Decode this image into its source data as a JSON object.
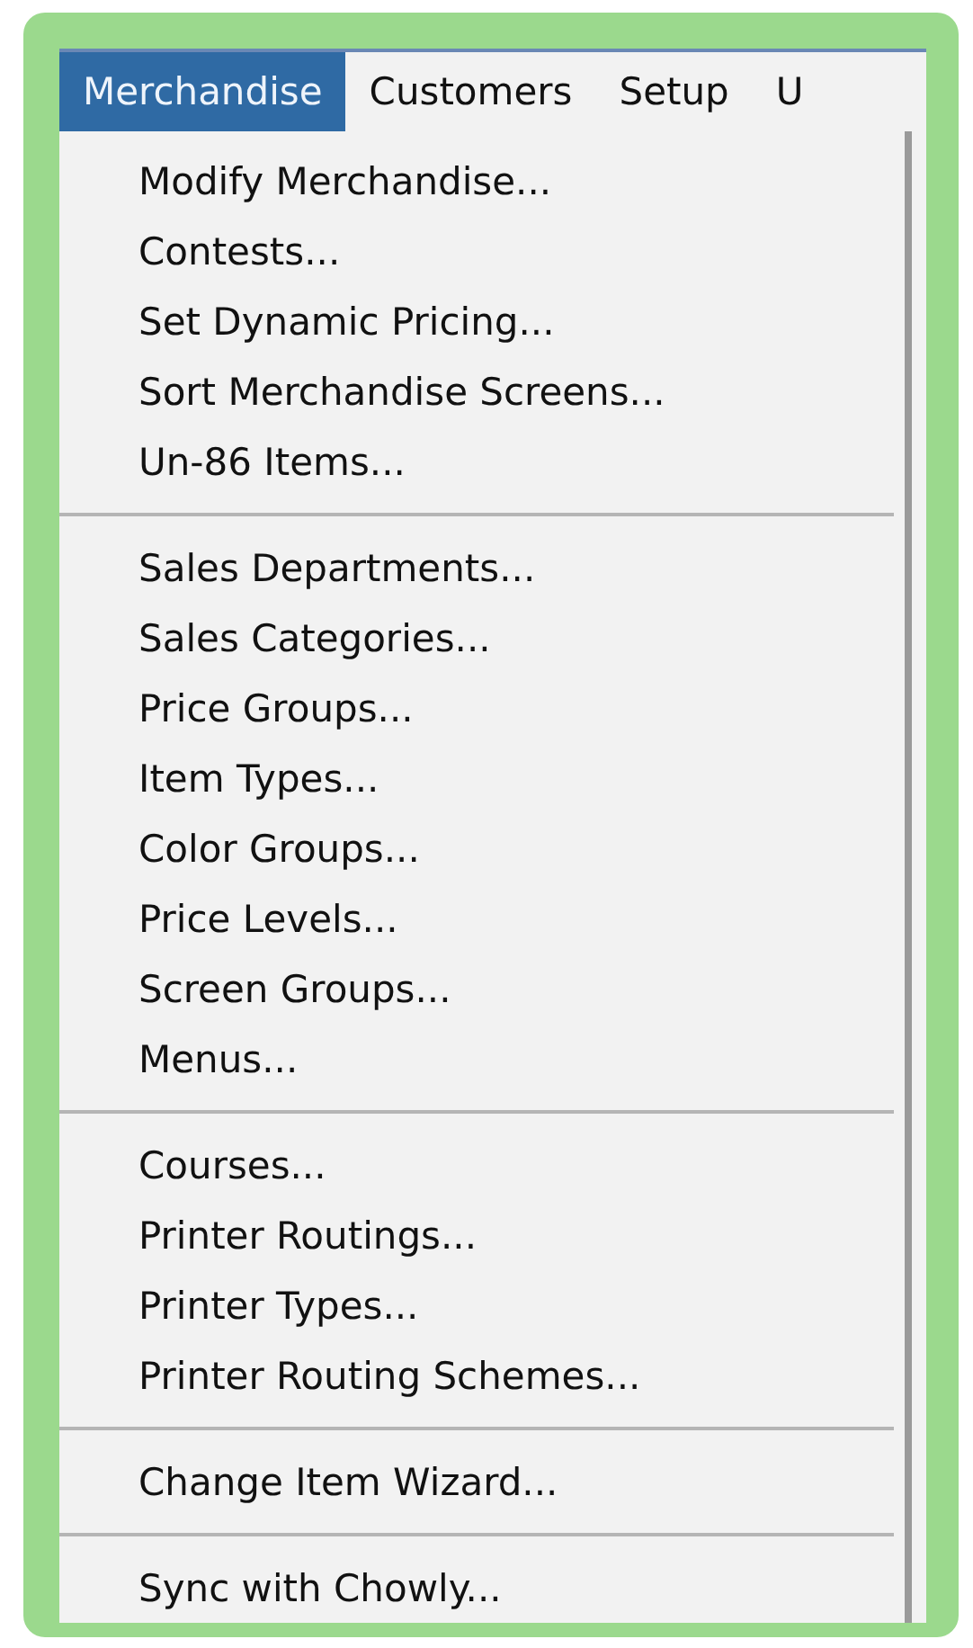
{
  "menu_bar": [
    {
      "label": "Merchandise",
      "selected": true
    },
    {
      "label": "Customers",
      "selected": false
    },
    {
      "label": "Setup",
      "selected": false
    },
    {
      "label": "U",
      "selected": false
    }
  ],
  "dropdown": {
    "groups": [
      {
        "items": [
          "Modify Merchandise...",
          "Contests...",
          "Set Dynamic Pricing...",
          "Sort Merchandise Screens...",
          "Un-86 Items..."
        ]
      },
      {
        "items": [
          "Sales Departments...",
          "Sales Categories...",
          "Price Groups...",
          "Item Types...",
          "Color Groups...",
          "Price Levels...",
          "Screen Groups...",
          "Menus..."
        ]
      },
      {
        "items": [
          "Courses...",
          "Printer Routings...",
          "Printer Types...",
          "Printer Routing Schemes..."
        ]
      },
      {
        "items": [
          "Change Item Wizard..."
        ]
      },
      {
        "items": [
          "Sync with Chowly..."
        ]
      }
    ]
  }
}
